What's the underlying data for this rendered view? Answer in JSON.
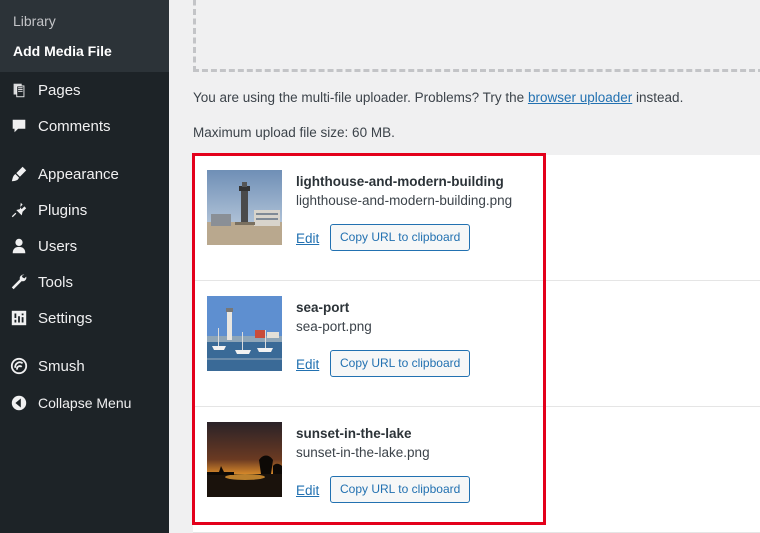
{
  "sidebar": {
    "submenu": {
      "library": "Library",
      "add_media_file": "Add Media File"
    },
    "items": [
      {
        "label": "Pages",
        "icon": "pages-icon"
      },
      {
        "label": "Comments",
        "icon": "comments-icon"
      },
      {
        "label": "Appearance",
        "icon": "appearance-icon"
      },
      {
        "label": "Plugins",
        "icon": "plugins-icon"
      },
      {
        "label": "Users",
        "icon": "users-icon"
      },
      {
        "label": "Tools",
        "icon": "tools-icon"
      },
      {
        "label": "Settings",
        "icon": "settings-icon"
      },
      {
        "label": "Smush",
        "icon": "smush-icon"
      },
      {
        "label": "Collapse Menu",
        "icon": "collapse-icon"
      }
    ]
  },
  "main": {
    "note_prefix": "You are using the multi-file uploader. Problems? Try the",
    "note_link": "browser uploader",
    "note_suffix": "instead.",
    "max_size": "Maximum upload file size: 60 MB.",
    "media_items": [
      {
        "title": "lighthouse-and-modern-building",
        "file": "lighthouse-and-modern-building.png",
        "edit": "Edit",
        "copy": "Copy URL to clipboard"
      },
      {
        "title": "sea-port",
        "file": "sea-port.png",
        "edit": "Edit",
        "copy": "Copy URL to clipboard"
      },
      {
        "title": "sunset-in-the-lake",
        "file": "sunset-in-the-lake.png",
        "edit": "Edit",
        "copy": "Copy URL to clipboard"
      }
    ]
  },
  "colors": {
    "sidebar_bg": "#1d2327",
    "submenu_bg": "#2c3338",
    "link": "#2271b1",
    "highlight": "#e3001b"
  }
}
